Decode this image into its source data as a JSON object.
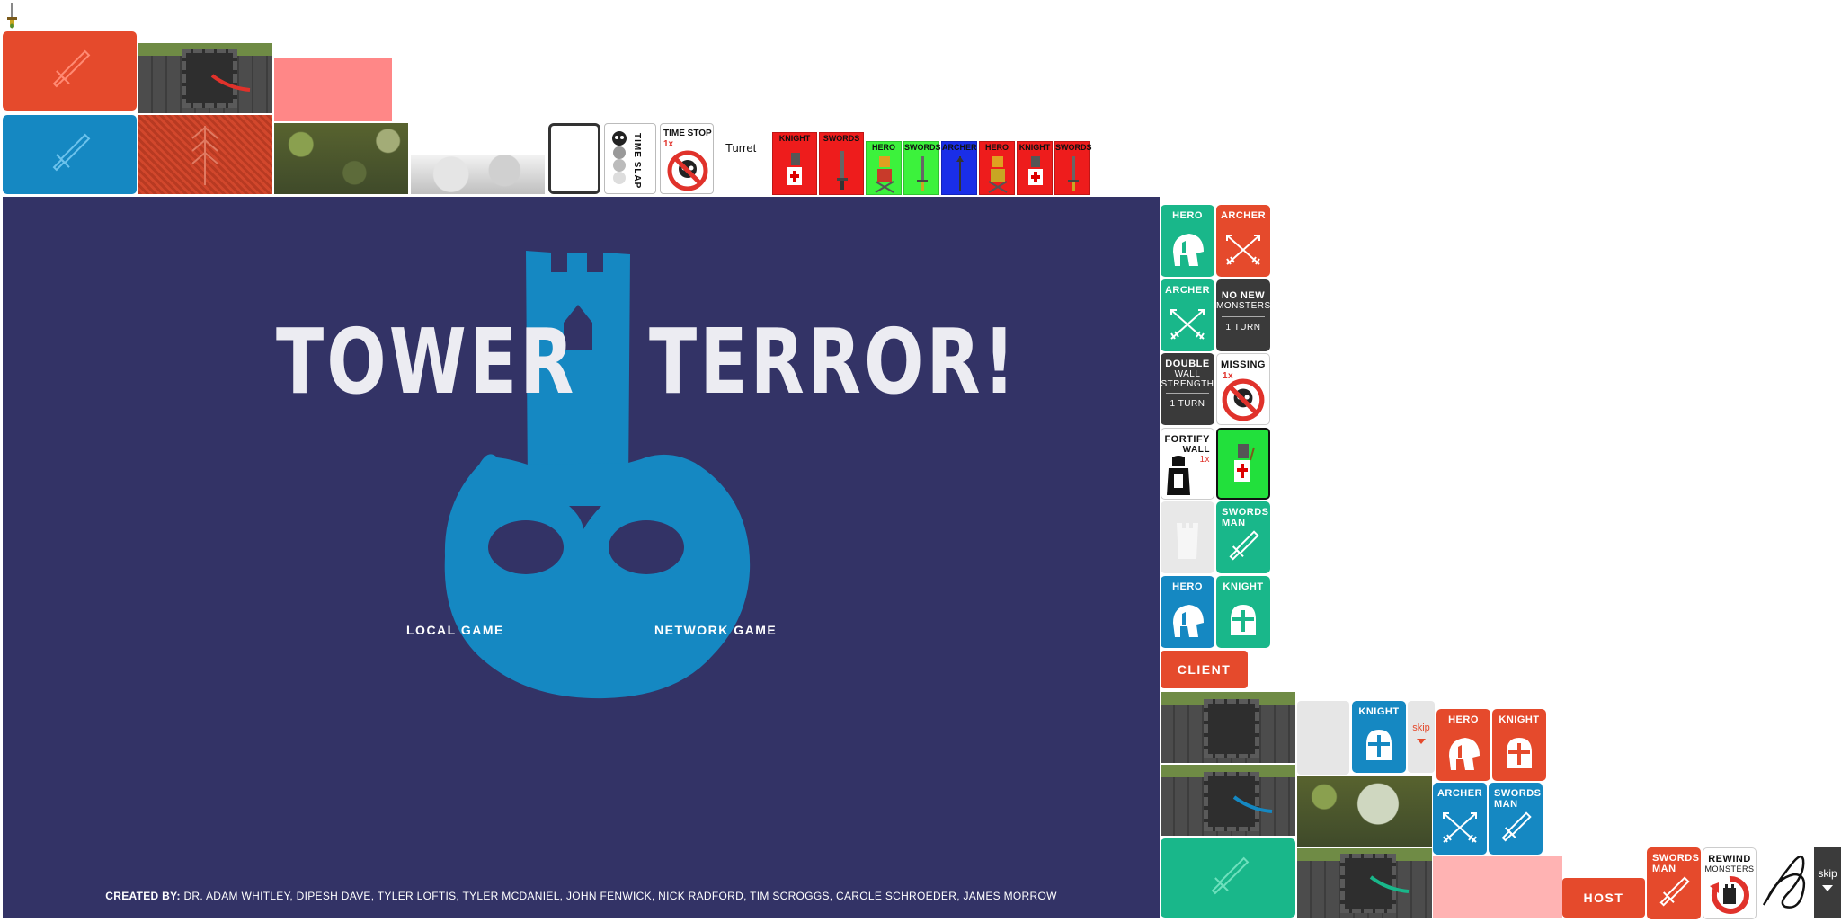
{
  "colors": {
    "main_bg": "#333366",
    "accent_blue": "#1588c2",
    "accent_red": "#e54a2c",
    "accent_teal": "#19b78a",
    "title_text": "#ececf2"
  },
  "sprites": {
    "turret_label": "Turret",
    "time_slap_label": "TIME SLAP",
    "time_stop": {
      "title": "TIME STOP",
      "uses": "1x"
    },
    "unit_sprites": [
      "KNIGHT",
      "SWORDS",
      "HERO",
      "SWORDS",
      "ARCHER",
      "HERO",
      "KNIGHT",
      "SWORDS"
    ]
  },
  "main_menu": {
    "title_left": "TOWER",
    "title_right": "TERROR!",
    "local_game": "LOCAL GAME",
    "network_game": "NETWORK GAME",
    "credits_label": "CREATED BY:",
    "credits_names": "DR. ADAM WHITLEY, DIPESH DAVE, TYLER LOFTIS, TYLER MCDANIEL, JOHN FENWICK, NICK RADFORD, TIM SCROGGS, CAROLE SCHROEDER, JAMES MORROW"
  },
  "cards": {
    "hero": "HERO",
    "archer": "ARCHER",
    "knight": "KNIGHT",
    "swords": "SWORDS",
    "man": "MAN",
    "no_new": "NO NEW",
    "monsters": "MONSTERS",
    "one_turn": "1 TURN",
    "double": "DOUBLE",
    "wall": "WALL",
    "strength": "STRENGTH",
    "missing": "MISSING",
    "one_x": "1x",
    "fortify": "FORTIFY",
    "rewind": "REWIND"
  },
  "buttons": {
    "client": "CLIENT",
    "host": "HOST",
    "skip": "skip"
  }
}
